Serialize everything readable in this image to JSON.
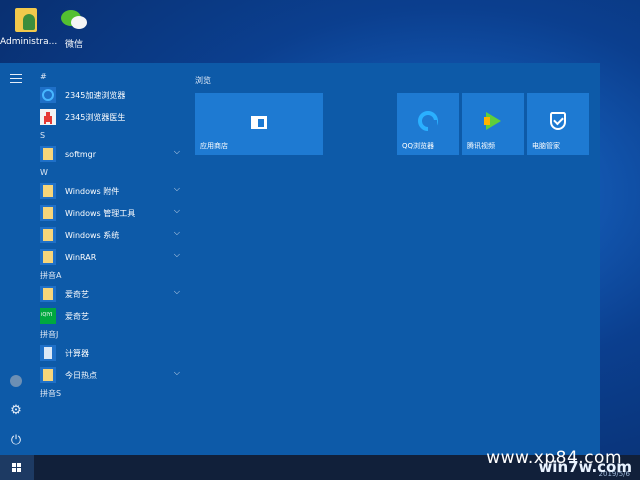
{
  "desktop": {
    "icons": [
      {
        "label": "Administra..."
      },
      {
        "label": "微信"
      }
    ]
  },
  "start_menu": {
    "app_list": {
      "groups": [
        {
          "header": "#",
          "items": [
            "2345加速浏览器",
            "2345浏览器医生"
          ]
        },
        {
          "header": "S",
          "items": [
            "softmgr"
          ]
        },
        {
          "header": "W",
          "items": [
            "Windows 附件",
            "Windows 管理工具",
            "Windows 系统",
            "WinRAR"
          ]
        },
        {
          "header": "拼音A",
          "items": [
            "爱奇艺",
            "爱奇艺"
          ]
        },
        {
          "header": "拼音J",
          "items": [
            "计算器",
            "今日热点"
          ]
        },
        {
          "header": "拼音S",
          "items": []
        }
      ]
    },
    "tiles": {
      "section_title": "浏览",
      "items": [
        "应用商店",
        "QQ浏览器",
        "腾讯视频",
        "电脑管家"
      ]
    }
  },
  "watermark": {
    "text1": "www.xp84.com",
    "text2": "win7w.com",
    "date": "2019/5/6"
  }
}
